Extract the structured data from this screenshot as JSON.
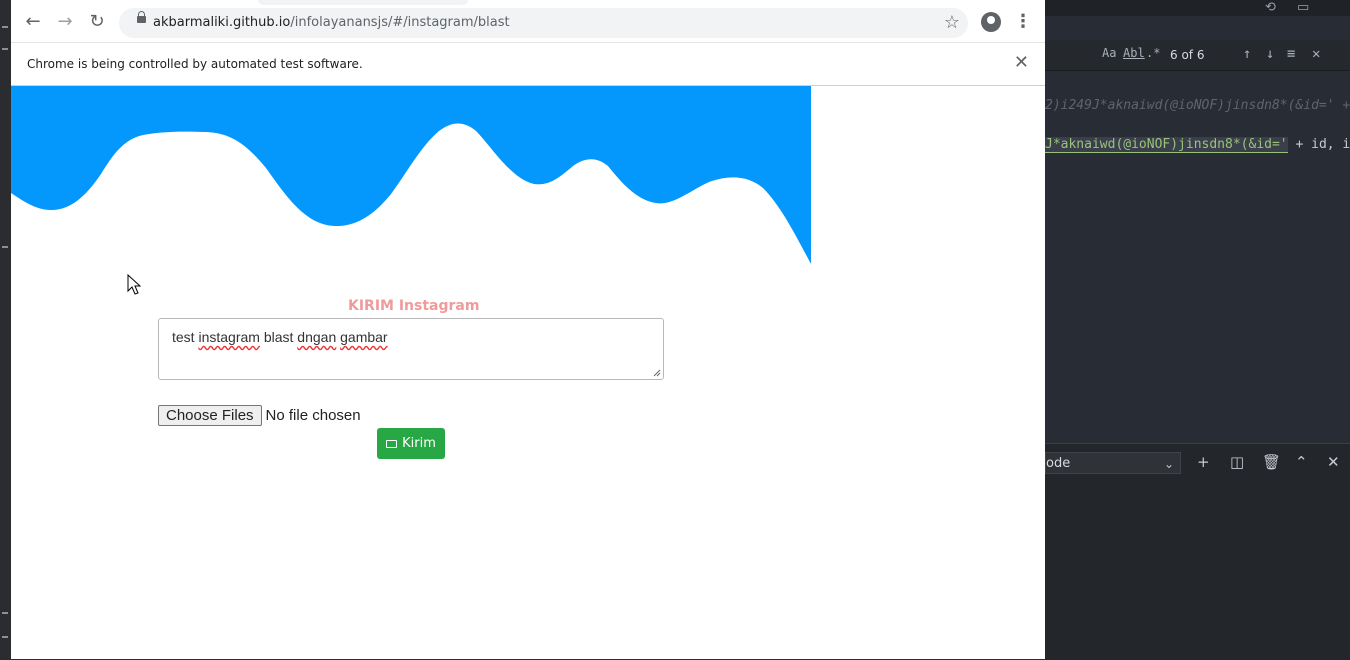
{
  "browser": {
    "url_host": "akbarmaliki.github.io",
    "url_path": "/infolayanansjs/#/instagram/blast",
    "infobar_text": "Chrome is being controlled by automated test software."
  },
  "form": {
    "title": "KIRIM Instagram",
    "message_words": [
      "test",
      "instagram",
      "blast",
      "dngan",
      "gambar"
    ],
    "choose_files_label": "Choose Files",
    "file_status": "No file chosen",
    "send_label": "Kirim",
    "send_icon": "envelope-icon"
  },
  "ide": {
    "find_count": "6 of 6",
    "code_line_1": "2)i249J*aknaiwd(@ioNOF)jinsdn8*(&id=' +",
    "code_line_2_match": "J*aknaiwd(@ioNOF)jinsdn8*(&id='",
    "code_line_2_rest": " + id, i",
    "select_value": "ode"
  },
  "colors": {
    "wave": "#0497fc",
    "title": "#f19a9a",
    "send_button": "#28a745"
  }
}
